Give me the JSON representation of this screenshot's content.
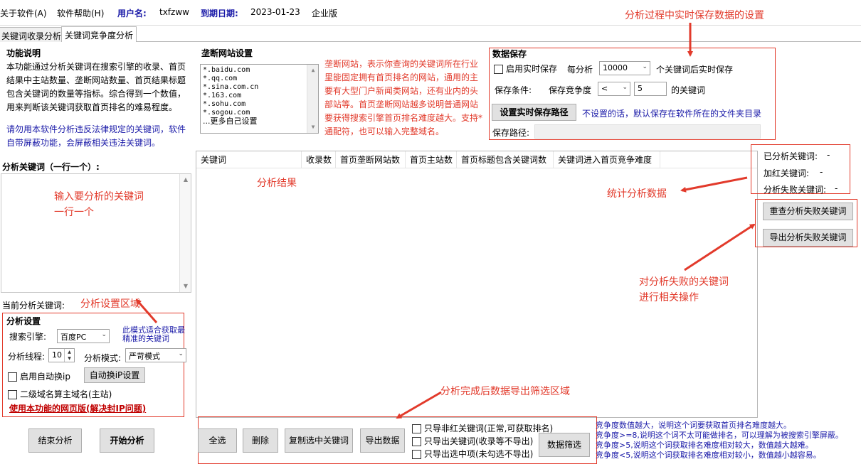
{
  "menu": {
    "about": "关于软件(A)",
    "help": "软件帮助(H)",
    "user_label": "用户名:",
    "user_value": "txfzww",
    "expire_label": "到期日期:",
    "expire_value": "2023-01-23",
    "edition": "企业版"
  },
  "tabs": [
    "关键词收录分析",
    "关键词竞争度分析"
  ],
  "func": {
    "title": "功能说明",
    "desc": "本功能通过分析关键词在搜索引擎的收录、首页结果中主站数量、垄断网站数量、首页结果标题包含关键词的数量等指标。综合得到一个数值，用来判断该关键词获取首页排名的难易程度。",
    "warning": "请勿用本软件分析违反法律规定的关键词，软件自带屏蔽功能，会屏蔽相关违法关键词。"
  },
  "monopoly": {
    "title": "垄断网站设置",
    "sites": [
      "*.baidu.com",
      "*.qq.com",
      "*.sina.com.cn",
      "*.163.com",
      "*.sohu.com",
      "*.sogou.com",
      "...更多自己设置"
    ],
    "note": "垄断网站，表示你查询的关键词所在行业里能固定拥有首页排名的网站，通用的主要有大型门户新闻类网站，还有业内的头部站等。首页垄断网站越多说明普通网站要获得搜索引擎首页排名难度越大。支持*通配符，也可以输入完整域名。"
  },
  "save": {
    "title": "数据保存",
    "realtime_label": "启用实时保存",
    "every_label": "每分析",
    "every_value": "10000",
    "after_label": "个关键词后实时保存",
    "cond_label": "保存条件:",
    "cond_kw": "保存竞争度",
    "cond_op": "<",
    "cond_value": "5",
    "cond_suffix": "的关键词",
    "path_button": "设置实时保存路径",
    "path_hint": "不设置的话，默认保存在软件所在的文件夹目录",
    "path_label": "保存路径:"
  },
  "input": {
    "title": "分析关键词（一行一个）:",
    "current_label": "当前分析关键词:"
  },
  "results": {
    "columns": [
      "关键词",
      "收录数",
      "首页垄断网站数",
      "首页主站数",
      "首页标题包含关键词数",
      "关键词进入首页竞争难度"
    ]
  },
  "stats": {
    "analyzed_label": "已分析关键词:",
    "analyzed_value": "-",
    "red_label": "加红关键词:",
    "red_value": "-",
    "failed_label": "分析失败关键词:",
    "failed_value": "-"
  },
  "fail_ops": {
    "recheck": "重查分析失败关键词",
    "export": "导出分析失败关键词"
  },
  "settings": {
    "title": "分析设置",
    "engine_label": "搜索引擎:",
    "engine_value": "百度PC",
    "mode_hint": "此模式适合获取最精准的关键词",
    "threads_label": "分析线程:",
    "threads_value": "10",
    "mode_label": "分析模式:",
    "mode_value": "严苛模式",
    "auto_ip_label": "启用自动换ip",
    "auto_ip_button": "自动换iP设置",
    "subdomain_label": "二级域名算主域名(主站)",
    "web_link": "使用本功能的网页版(解决封IP问题)"
  },
  "actions": {
    "stop": "结束分析",
    "start": "开始分析"
  },
  "export": {
    "select_all": "全选",
    "delete": "删除",
    "copy": "复制选中关键词",
    "export": "导出数据",
    "opt1": "只导非红关键词(正常,可获取排名)",
    "opt2": "只导出关键词(收录等不导出)",
    "opt3": "只导出选中项(未勾选不导出)",
    "filter": "数据筛选"
  },
  "hints": [
    "竞争度数值越大，说明这个词要获取首页排名难度越大。",
    "竞争度>=8,说明这个词不太可能做排名，可以理解为被搜索引擎屏蔽。",
    "竞争度>5,说明这个词获取排名难度相对较大，数值越大越难。",
    "竞争度<5,说明这个词获取排名难度相对较小，数值越小越容易。"
  ],
  "annotations": {
    "save_setting": "分析过程中实时保存数据的设置",
    "input_hint_1": "输入要分析的关键词",
    "input_hint_2": "一行一个",
    "results": "分析结果",
    "stats": "统计分析数据",
    "fail_ops_1": "对分析失败的关键词",
    "fail_ops_2": "进行相关操作",
    "settings_area": "分析设置区域",
    "export_area": "分析完成后数据导出筛选区域"
  },
  "colors": {
    "annotation": "#e23a2b",
    "label_blue": "#1a1aa8",
    "web_link": "#c00000"
  }
}
